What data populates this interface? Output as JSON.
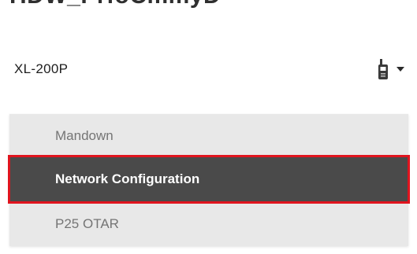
{
  "header": {
    "title": "HDW_PrfoCmmyD"
  },
  "device_selector": {
    "selected_value": "XL-200P",
    "icon": "radio-icon",
    "caret_icon": "chevron-down-icon"
  },
  "menu": {
    "items": [
      {
        "label": "Mandown",
        "highlighted": false
      },
      {
        "label": "Network Configuration",
        "highlighted": true
      },
      {
        "label": "P25 OTAR",
        "highlighted": false
      }
    ],
    "highlight_border_color": "#e0141e",
    "selected_background": "#4a4a4a"
  }
}
